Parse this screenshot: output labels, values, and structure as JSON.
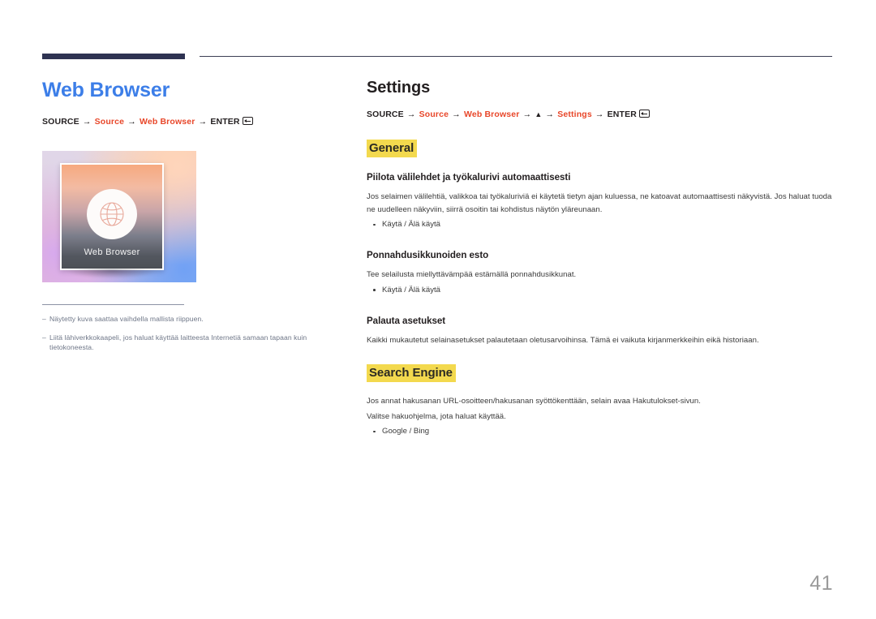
{
  "page": {
    "number": "41"
  },
  "left": {
    "title": "Web Browser",
    "path": {
      "prefix": "SOURCE",
      "steps": [
        "Source",
        "Web Browser"
      ],
      "suffix": "ENTER",
      "arrow": "→"
    },
    "figure": {
      "label": "Web Browser",
      "icon": "globe-icon"
    },
    "notes": [
      "Näytetty kuva saattaa vaihdella mallista riippuen.",
      "Liitä lähiverkkokaapeli, jos haluat käyttää laitteesta Internetiä samaan tapaan kuin tietokoneesta."
    ],
    "note_dash": "–"
  },
  "right": {
    "title": "Settings",
    "path": {
      "prefix": "SOURCE",
      "step1": "Source",
      "step2": "Web Browser",
      "triangle": "▲",
      "step3": "Settings",
      "suffix": "ENTER",
      "arrow": "→"
    },
    "sections": [
      {
        "heading": "General",
        "items": [
          {
            "title": "Piilota välilehdet ja työkalurivi automaattisesti",
            "body": "Jos selaimen välilehtiä, valikkoa tai työkaluriviä ei käytetä tietyn ajan kuluessa, ne katoavat automaattisesti näkyvistä. Jos haluat tuoda ne uudelleen näkyviin, siirrä osoitin tai kohdistus näytön yläreunaan.",
            "options": [
              "Käytä / Älä käytä"
            ]
          },
          {
            "title": "Ponnahdusikkunoiden esto",
            "body": "Tee selailusta miellyttävämpää estämällä ponnahdusikkunat.",
            "options": [
              "Käytä / Älä käytä"
            ]
          },
          {
            "title": "Palauta asetukset",
            "body": "Kaikki mukautetut selainasetukset palautetaan oletusarvoihinsa. Tämä ei vaikuta kirjanmerkkeihin eikä historiaan.",
            "options": []
          }
        ]
      },
      {
        "heading": "Search Engine",
        "body1": "Jos annat hakusanan URL-osoitteen/hakusanan syöttökenttään, selain avaa Hakutulokset-sivun.",
        "body2": "Valitse hakuohjelma, jota haluat käyttää.",
        "options": [
          "Google / Bing"
        ]
      }
    ]
  },
  "colors": {
    "title_blue": "#3c7ee8",
    "accent_orange": "#e8472a",
    "highlight_yellow": "#f3d94e",
    "rule_navy": "#2e3352",
    "note_gray": "#6e7687",
    "page_number_gray": "#9b9b9b"
  }
}
